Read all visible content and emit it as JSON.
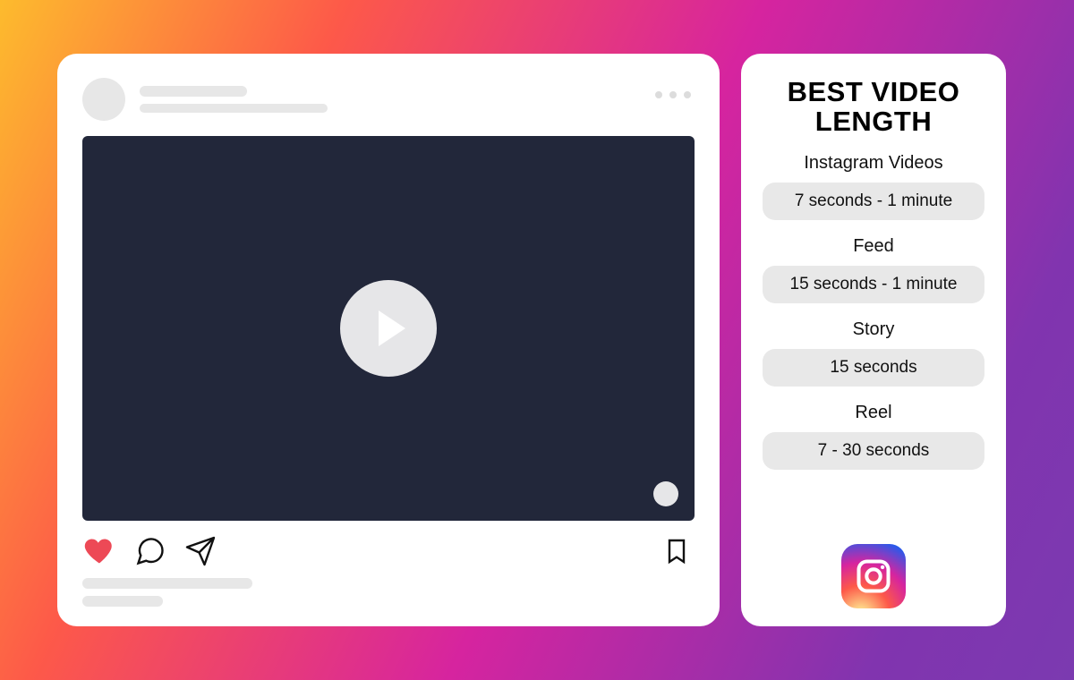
{
  "post": {
    "like_liked": true
  },
  "sidebar": {
    "title": "BEST VIDEO LENGTH",
    "groups": [
      {
        "label": "Instagram Videos",
        "value": "7 seconds - 1 minute"
      },
      {
        "label": "Feed",
        "value": "15 seconds - 1 minute"
      },
      {
        "label": "Story",
        "value": "15 seconds"
      },
      {
        "label": "Reel",
        "value": "7 - 30 seconds"
      }
    ]
  }
}
